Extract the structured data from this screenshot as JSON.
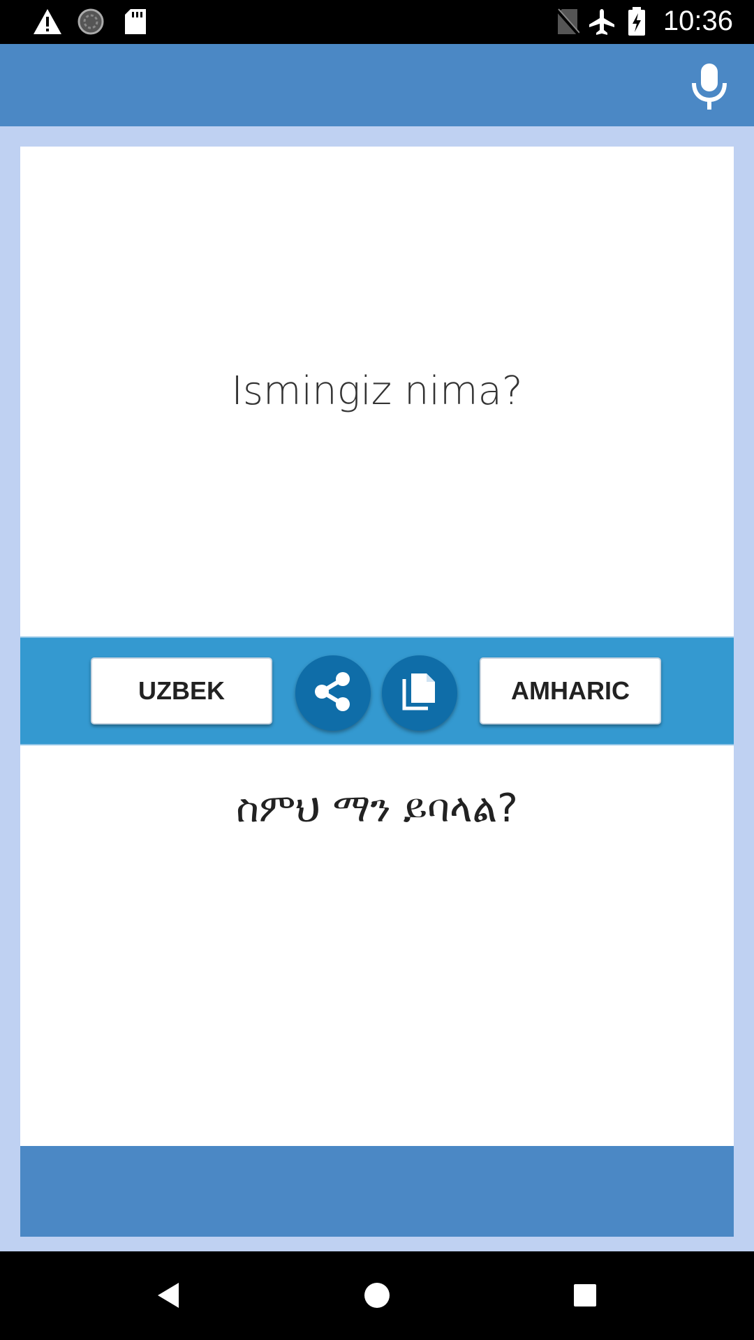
{
  "status_bar": {
    "time": "10:36",
    "left_icons": [
      "warning-icon",
      "sync-icon",
      "sd-card-icon"
    ],
    "right_icons": [
      "no-sim-icon",
      "airplane-mode-icon",
      "battery-charging-icon"
    ]
  },
  "app_bar": {
    "action_icon": "microphone-icon"
  },
  "translation": {
    "source_text": "Ismingiz nima?",
    "target_text": "ስምህ ማን ይባላል?"
  },
  "controls": {
    "source_language": "UZBEK",
    "target_language": "AMHARIC",
    "share_icon": "share-icon",
    "copy_icon": "copy-icon"
  },
  "navigation": {
    "buttons": [
      "back-icon",
      "home-icon",
      "recents-icon"
    ]
  },
  "colors": {
    "app_bar": "#4b88c5",
    "background": "#bfd1f2",
    "controls_bar": "#3499d0",
    "round_button": "#0f6da8"
  }
}
